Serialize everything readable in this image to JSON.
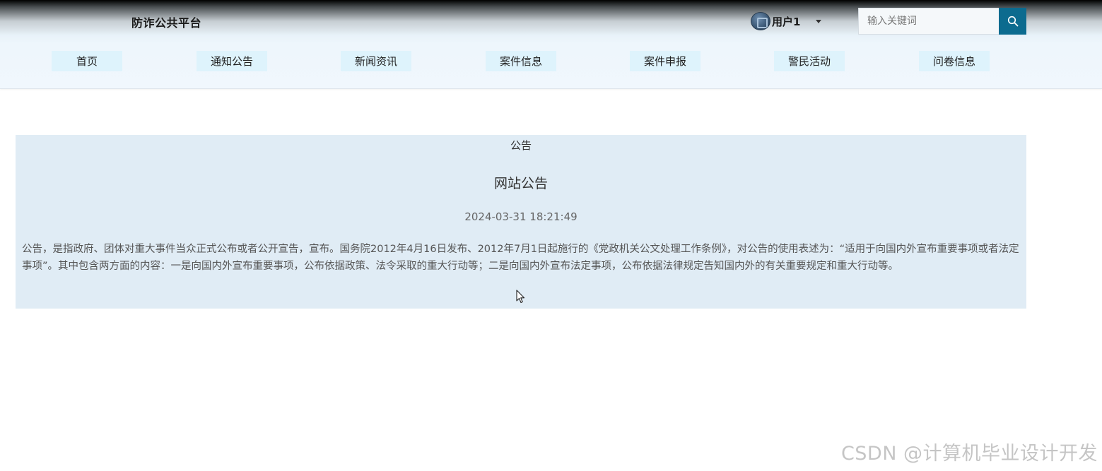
{
  "header": {
    "brand": "防诈公共平台",
    "user": {
      "name": "用户1"
    },
    "search": {
      "placeholder": "输入关键词"
    }
  },
  "nav": {
    "items": [
      {
        "label": "首页"
      },
      {
        "label": "通知公告"
      },
      {
        "label": "新闻资讯"
      },
      {
        "label": "案件信息"
      },
      {
        "label": "案件申报"
      },
      {
        "label": "警民活动"
      },
      {
        "label": "问卷信息"
      }
    ]
  },
  "notice": {
    "section_label": "公告",
    "title": "网站公告",
    "time": "2024-03-31 18:21:49",
    "body": "公告，是指政府、团体对重大事件当众正式公布或者公开宣告，宣布。国务院2012年4月16日发布、2012年7月1日起施行的《党政机关公文处理工作条例》，对公告的使用表述为：“适用于向国内外宣布重要事项或者法定事项”。其中包含两方面的内容：一是向国内外宣布重要事项，公布依据政策、法令采取的重大行动等；二是向国内外宣布法定事项，公布依据法律规定告知国内外的有关重要规定和重大行动等。"
  },
  "watermark": "CSDN @计算机毕业设计开发",
  "colors": {
    "nav_bg": "#def3fc",
    "search_button": "#0c6b8f",
    "panel_bg": "#e0ecf5"
  }
}
